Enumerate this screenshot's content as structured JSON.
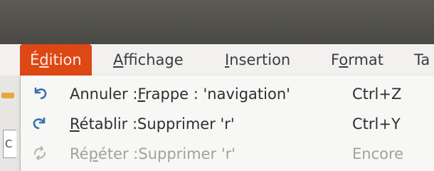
{
  "menubar": {
    "items": [
      {
        "pre": "É",
        "mn": "d",
        "post": "ition",
        "state": "open"
      },
      {
        "pre": "",
        "mn": "A",
        "post": "ffichage",
        "state": "closed"
      },
      {
        "pre": "",
        "mn": "I",
        "post": "nsertion",
        "state": "closed"
      },
      {
        "pre": "F",
        "mn": "o",
        "post": "rmat",
        "state": "closed"
      },
      {
        "pre": "Ta",
        "mn": "",
        "post": "",
        "state": "closed"
      }
    ]
  },
  "left_edge": {
    "fragment_text": "C"
  },
  "menu": {
    "items": [
      {
        "icon": "undo-icon",
        "pre": "Annuler :",
        "mn": "F",
        "post": "rappe : 'navigation'",
        "accel": "Ctrl+Z",
        "enabled": true
      },
      {
        "icon": "redo-icon",
        "pre": "",
        "mn": "R",
        "post": "établir :Supprimer 'r'",
        "accel": "Ctrl+Y",
        "enabled": true
      },
      {
        "icon": "repeat-icon",
        "pre": "Ré",
        "mn": "p",
        "post": "éter :Supprimer 'r'",
        "accel": "Encore",
        "enabled": false
      }
    ]
  },
  "colors": {
    "accent": "#dd4814",
    "titlebar": "#4f4e49",
    "icon_blue": "#3a6fb0",
    "disabled_text": "#a4a19c"
  }
}
